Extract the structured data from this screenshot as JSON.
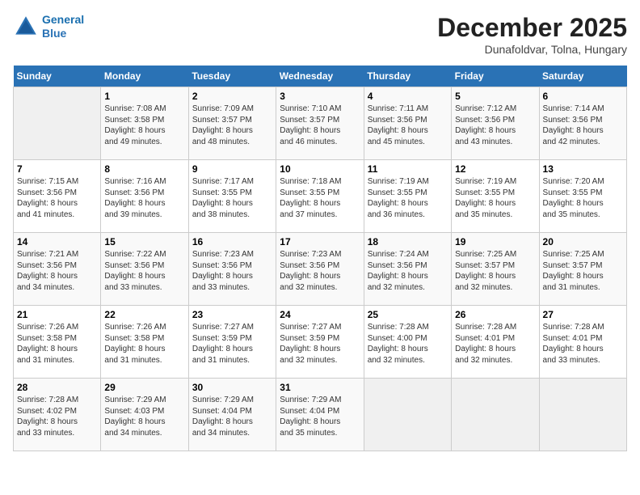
{
  "header": {
    "logo_line1": "General",
    "logo_line2": "Blue",
    "month": "December 2025",
    "location": "Dunafoldvar, Tolna, Hungary"
  },
  "days_of_week": [
    "Sunday",
    "Monday",
    "Tuesday",
    "Wednesday",
    "Thursday",
    "Friday",
    "Saturday"
  ],
  "weeks": [
    [
      {
        "day": "",
        "info": ""
      },
      {
        "day": "1",
        "info": "Sunrise: 7:08 AM\nSunset: 3:58 PM\nDaylight: 8 hours\nand 49 minutes."
      },
      {
        "day": "2",
        "info": "Sunrise: 7:09 AM\nSunset: 3:57 PM\nDaylight: 8 hours\nand 48 minutes."
      },
      {
        "day": "3",
        "info": "Sunrise: 7:10 AM\nSunset: 3:57 PM\nDaylight: 8 hours\nand 46 minutes."
      },
      {
        "day": "4",
        "info": "Sunrise: 7:11 AM\nSunset: 3:56 PM\nDaylight: 8 hours\nand 45 minutes."
      },
      {
        "day": "5",
        "info": "Sunrise: 7:12 AM\nSunset: 3:56 PM\nDaylight: 8 hours\nand 43 minutes."
      },
      {
        "day": "6",
        "info": "Sunrise: 7:14 AM\nSunset: 3:56 PM\nDaylight: 8 hours\nand 42 minutes."
      }
    ],
    [
      {
        "day": "7",
        "info": "Sunrise: 7:15 AM\nSunset: 3:56 PM\nDaylight: 8 hours\nand 41 minutes."
      },
      {
        "day": "8",
        "info": "Sunrise: 7:16 AM\nSunset: 3:56 PM\nDaylight: 8 hours\nand 39 minutes."
      },
      {
        "day": "9",
        "info": "Sunrise: 7:17 AM\nSunset: 3:55 PM\nDaylight: 8 hours\nand 38 minutes."
      },
      {
        "day": "10",
        "info": "Sunrise: 7:18 AM\nSunset: 3:55 PM\nDaylight: 8 hours\nand 37 minutes."
      },
      {
        "day": "11",
        "info": "Sunrise: 7:19 AM\nSunset: 3:55 PM\nDaylight: 8 hours\nand 36 minutes."
      },
      {
        "day": "12",
        "info": "Sunrise: 7:19 AM\nSunset: 3:55 PM\nDaylight: 8 hours\nand 35 minutes."
      },
      {
        "day": "13",
        "info": "Sunrise: 7:20 AM\nSunset: 3:55 PM\nDaylight: 8 hours\nand 35 minutes."
      }
    ],
    [
      {
        "day": "14",
        "info": "Sunrise: 7:21 AM\nSunset: 3:56 PM\nDaylight: 8 hours\nand 34 minutes."
      },
      {
        "day": "15",
        "info": "Sunrise: 7:22 AM\nSunset: 3:56 PM\nDaylight: 8 hours\nand 33 minutes."
      },
      {
        "day": "16",
        "info": "Sunrise: 7:23 AM\nSunset: 3:56 PM\nDaylight: 8 hours\nand 33 minutes."
      },
      {
        "day": "17",
        "info": "Sunrise: 7:23 AM\nSunset: 3:56 PM\nDaylight: 8 hours\nand 32 minutes."
      },
      {
        "day": "18",
        "info": "Sunrise: 7:24 AM\nSunset: 3:56 PM\nDaylight: 8 hours\nand 32 minutes."
      },
      {
        "day": "19",
        "info": "Sunrise: 7:25 AM\nSunset: 3:57 PM\nDaylight: 8 hours\nand 32 minutes."
      },
      {
        "day": "20",
        "info": "Sunrise: 7:25 AM\nSunset: 3:57 PM\nDaylight: 8 hours\nand 31 minutes."
      }
    ],
    [
      {
        "day": "21",
        "info": "Sunrise: 7:26 AM\nSunset: 3:58 PM\nDaylight: 8 hours\nand 31 minutes."
      },
      {
        "day": "22",
        "info": "Sunrise: 7:26 AM\nSunset: 3:58 PM\nDaylight: 8 hours\nand 31 minutes."
      },
      {
        "day": "23",
        "info": "Sunrise: 7:27 AM\nSunset: 3:59 PM\nDaylight: 8 hours\nand 31 minutes."
      },
      {
        "day": "24",
        "info": "Sunrise: 7:27 AM\nSunset: 3:59 PM\nDaylight: 8 hours\nand 32 minutes."
      },
      {
        "day": "25",
        "info": "Sunrise: 7:28 AM\nSunset: 4:00 PM\nDaylight: 8 hours\nand 32 minutes."
      },
      {
        "day": "26",
        "info": "Sunrise: 7:28 AM\nSunset: 4:01 PM\nDaylight: 8 hours\nand 32 minutes."
      },
      {
        "day": "27",
        "info": "Sunrise: 7:28 AM\nSunset: 4:01 PM\nDaylight: 8 hours\nand 33 minutes."
      }
    ],
    [
      {
        "day": "28",
        "info": "Sunrise: 7:28 AM\nSunset: 4:02 PM\nDaylight: 8 hours\nand 33 minutes."
      },
      {
        "day": "29",
        "info": "Sunrise: 7:29 AM\nSunset: 4:03 PM\nDaylight: 8 hours\nand 34 minutes."
      },
      {
        "day": "30",
        "info": "Sunrise: 7:29 AM\nSunset: 4:04 PM\nDaylight: 8 hours\nand 34 minutes."
      },
      {
        "day": "31",
        "info": "Sunrise: 7:29 AM\nSunset: 4:04 PM\nDaylight: 8 hours\nand 35 minutes."
      },
      {
        "day": "",
        "info": ""
      },
      {
        "day": "",
        "info": ""
      },
      {
        "day": "",
        "info": ""
      }
    ]
  ]
}
